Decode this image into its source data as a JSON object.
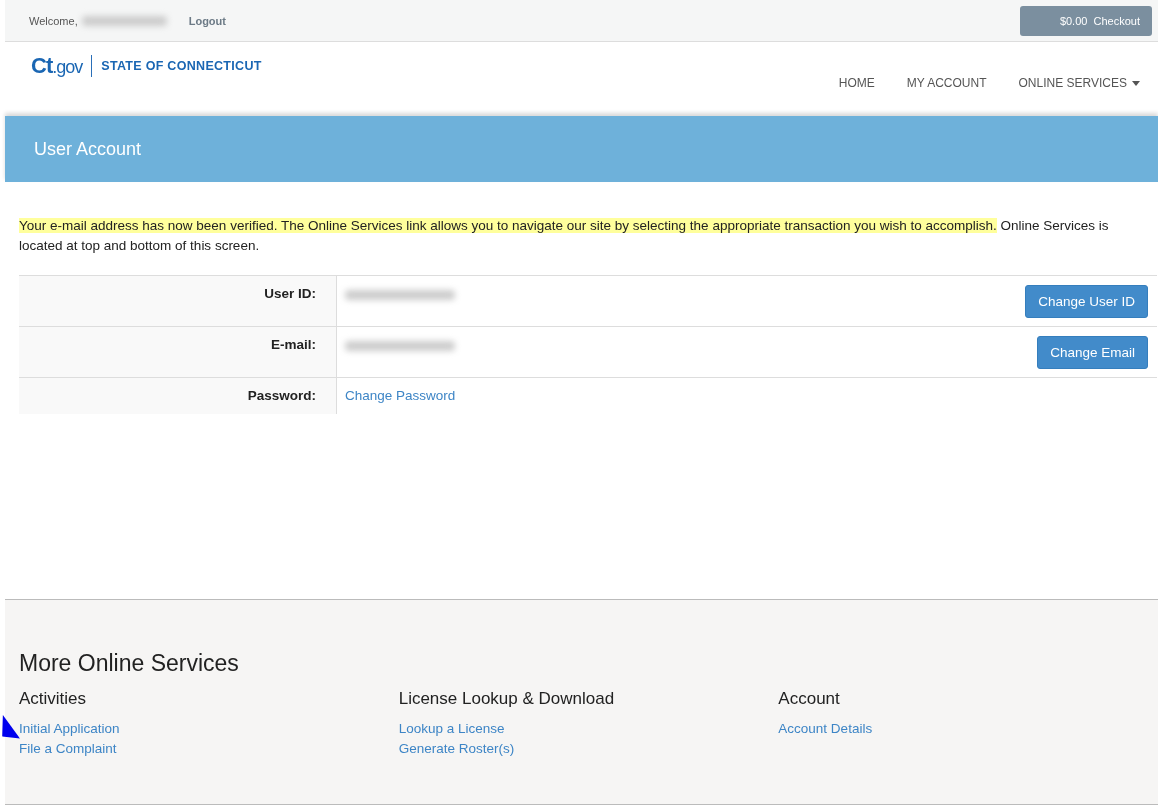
{
  "top_bar": {
    "welcome": "Welcome,",
    "user_redacted": true,
    "logout": "Logout",
    "cart_total": "$0.00",
    "checkout": "Checkout"
  },
  "logo": {
    "mark": "Ct",
    "suffix": ".gov",
    "title": "STATE OF CONNECTICUT"
  },
  "nav": [
    {
      "label": "HOME",
      "dropdown": false
    },
    {
      "label": "MY ACCOUNT",
      "dropdown": false
    },
    {
      "label": "ONLINE SERVICES",
      "dropdown": true
    }
  ],
  "banner": {
    "title": "User Account"
  },
  "message": [
    {
      "text": "Your e-mail address has now been verified. The Online Services link allows you to navigate our site by selecting the appropriate transaction you wish to accomplish.",
      "highlighted": true
    },
    {
      "text": "Online Services is located at top and bottom of this screen.",
      "highlighted": false
    }
  ],
  "account_rows": [
    {
      "label": "User ID:",
      "kind": "redacted",
      "button": "Change User ID"
    },
    {
      "label": "E-mail:",
      "kind": "redacted",
      "button": "Change Email"
    },
    {
      "label": "Password:",
      "kind": "link",
      "link": "Change Password"
    }
  ],
  "footer": {
    "title": "More Online Services",
    "columns": [
      {
        "heading": "Activities",
        "links": [
          "Initial Application",
          "File a Complaint"
        ]
      },
      {
        "heading": "License Lookup & Download",
        "links": [
          "Lookup a License",
          "Generate Roster(s)"
        ]
      },
      {
        "heading": "Account",
        "links": [
          "Account Details"
        ]
      }
    ]
  }
}
